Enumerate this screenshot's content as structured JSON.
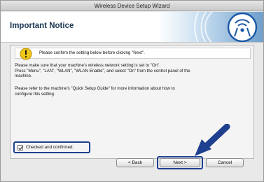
{
  "window": {
    "title": "Wireless Device Setup Wizard"
  },
  "header": {
    "title": "Important Notice",
    "icon": "wireless-signal-icon"
  },
  "notice": {
    "icon": "warning-icon",
    "text": "Please confirm the setting below before clicking \"Next\"."
  },
  "body": {
    "para1_line1": "Please make sure that your machine's wireless network setting is set to \"On\".",
    "para1_line2": "Press \"Menu\", \"LAN\", \"WLAN\", \"WLAN Enable\", and select \"On\" from the control panel of the",
    "para1_line3": "machine.",
    "para2_line1": "Please refer to the machine's \"Quick Setup Guide\" for more information about how to",
    "para2_line2": "configure this setting."
  },
  "confirm": {
    "label": "Checked and confirmed.",
    "checked": true
  },
  "buttons": {
    "back": "< Back",
    "next": "Next >",
    "cancel": "Cancel"
  },
  "colors": {
    "accent": "#1f3f8f",
    "header_title": "#1a3553"
  }
}
